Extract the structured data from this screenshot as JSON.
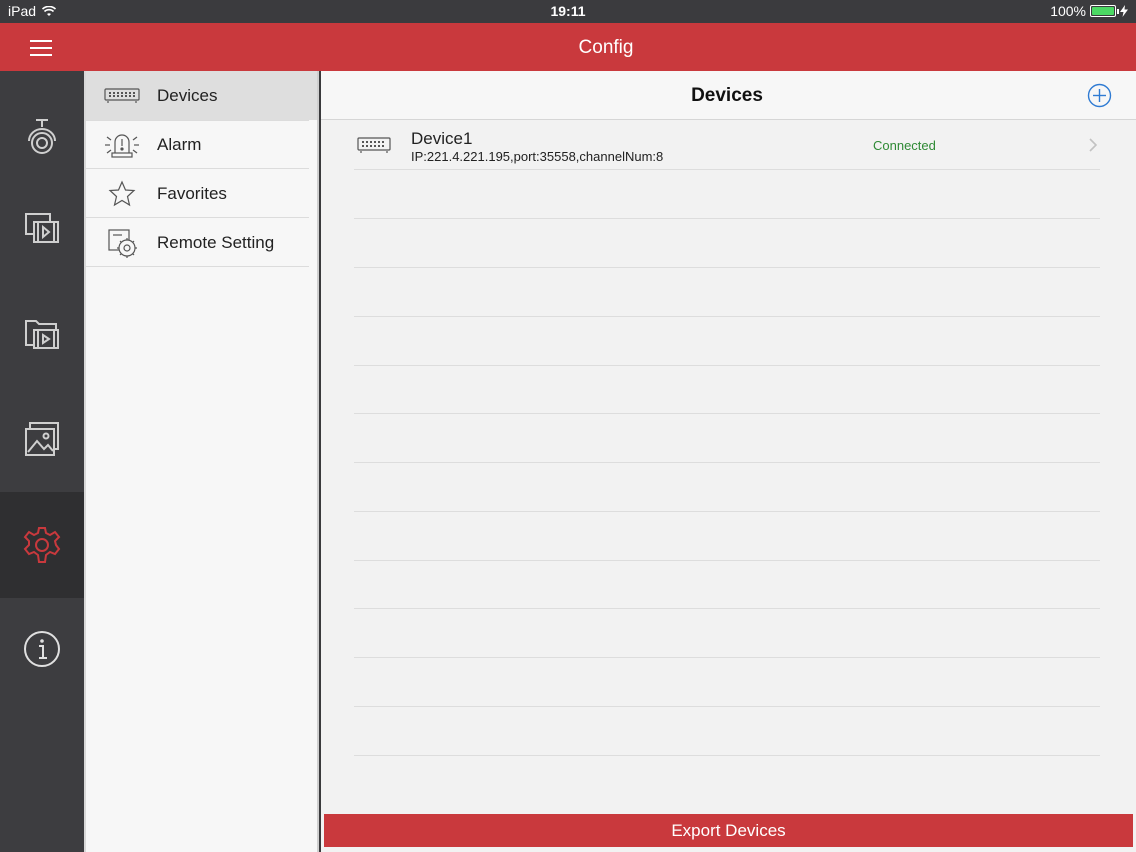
{
  "status_bar": {
    "device": "iPad",
    "time": "19:11",
    "battery": "100%"
  },
  "header": {
    "title": "Config",
    "menu_icon": "hamburger-icon"
  },
  "rail": {
    "items": [
      {
        "name": "camera-icon",
        "active": false
      },
      {
        "name": "playback-icon",
        "active": false
      },
      {
        "name": "video-files-icon",
        "active": false
      },
      {
        "name": "pictures-icon",
        "active": false
      },
      {
        "name": "settings-gear-icon",
        "active": true
      },
      {
        "name": "info-icon",
        "active": false
      }
    ],
    "active_color": "#c9393d"
  },
  "menu": {
    "items": [
      {
        "label": "Devices",
        "icon": "dvr-device-icon",
        "active": true
      },
      {
        "label": "Alarm",
        "icon": "alarm-siren-icon",
        "active": false
      },
      {
        "label": "Favorites",
        "icon": "star-icon",
        "active": false
      },
      {
        "label": "Remote Setting",
        "icon": "remote-setting-icon",
        "active": false
      }
    ]
  },
  "content": {
    "title": "Devices",
    "add_icon": "add-circle-icon",
    "devices": [
      {
        "name": "Device1",
        "info": "IP:221.4.221.195,port:35558,channelNum:8",
        "status": "Connected"
      }
    ],
    "export_label": "Export Devices"
  },
  "colors": {
    "brand": "#c9393d",
    "connected": "#2f8a35",
    "accent_blue": "#2f7bd3"
  }
}
